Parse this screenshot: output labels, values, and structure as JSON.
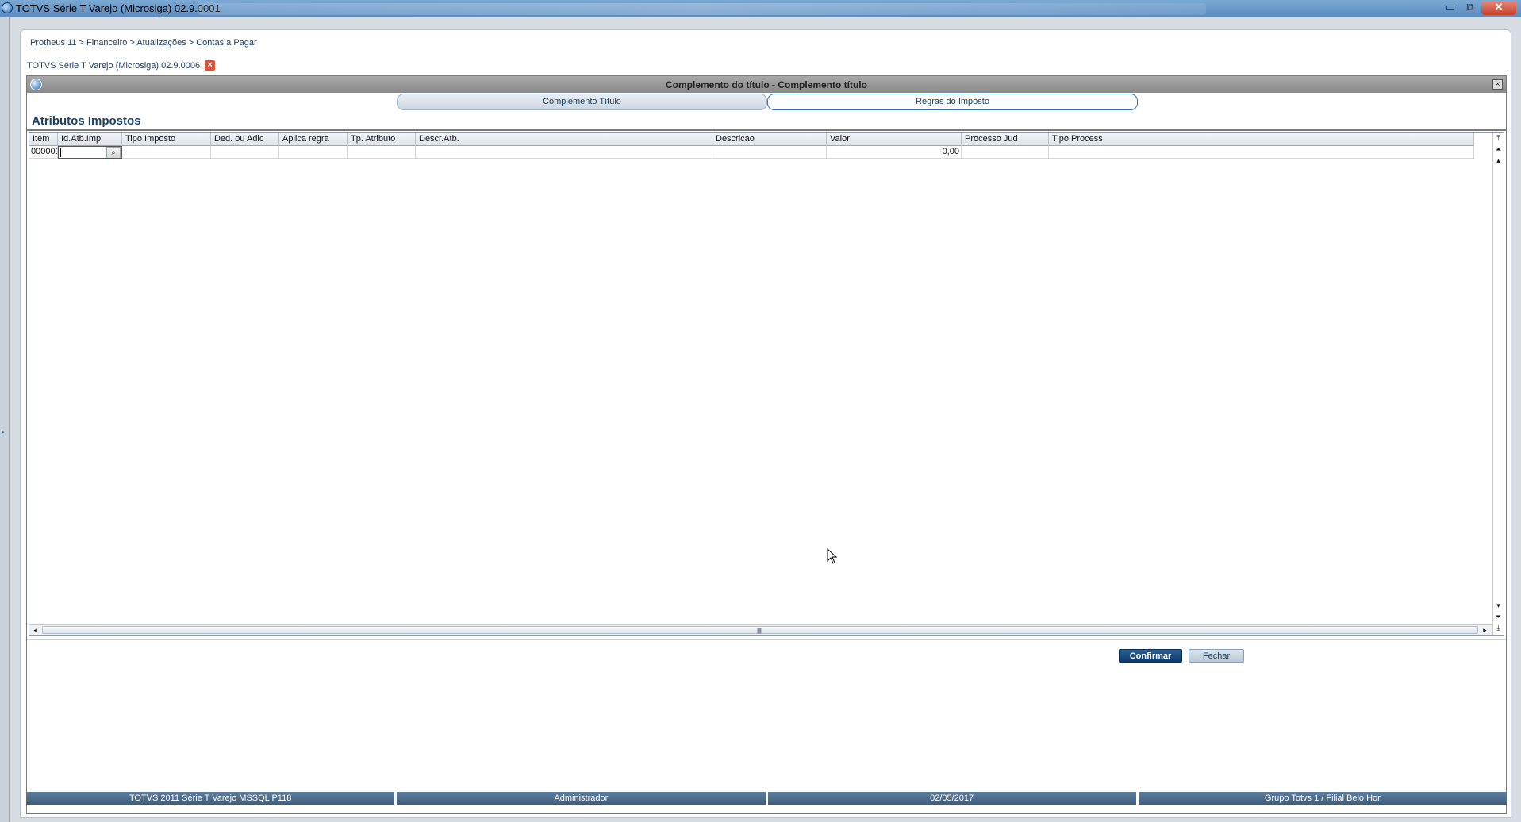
{
  "os_window": {
    "title": "TOTVS Série T Varejo (Microsiga) 02.9.0001",
    "min_label": "▭",
    "max_label": "⧉",
    "close_label": "✕"
  },
  "breadcrumb": "Protheus 11 > Financeiro > Atualizações > Contas a Pagar",
  "program_tab": {
    "label": "TOTVS Série T Varejo (Microsiga) 02.9.0006",
    "close_label": "×"
  },
  "dialog": {
    "title": "Complemento do título - Complemento título",
    "close_label": "×",
    "tabs": [
      {
        "label": "Complemento Título",
        "active": false
      },
      {
        "label": "Regras do Imposto",
        "active": true
      }
    ],
    "section_title": "Atributos Impostos",
    "grid": {
      "columns": [
        "Item",
        "Id.Atb.Imp",
        "Tipo Imposto",
        "Ded. ou Adic",
        "Aplica regra",
        "Tp. Atributo",
        "Descr.Atb.",
        "Descricao",
        "Valor",
        "Processo Jud",
        "Tipo Process"
      ],
      "rows": [
        {
          "item": "000001",
          "id_atb_imp": "",
          "tipo_imposto": "",
          "ded_ou_adic": "",
          "aplica_regra": "",
          "tp_atributo": "",
          "descr_atb": "",
          "descricao": "",
          "valor": "0,00",
          "processo_jud": "",
          "tipo_process": ""
        }
      ],
      "lookup_icon": "search-lookup-icon"
    },
    "buttons": {
      "confirm": "Confirmar",
      "close": "Fechar"
    }
  },
  "statusbar": {
    "environment": "TOTVS 2011 Série T Varejo MSSQL P118",
    "user": "Administrador",
    "date": "02/05/2017",
    "company": "Grupo Totvs 1 / Filial Belo Hor"
  },
  "colors": {
    "accent": "#1c3f66",
    "confirm_button": "#0e3a68",
    "statusbar": "#4a6987",
    "close_badge": "#d6533c"
  }
}
